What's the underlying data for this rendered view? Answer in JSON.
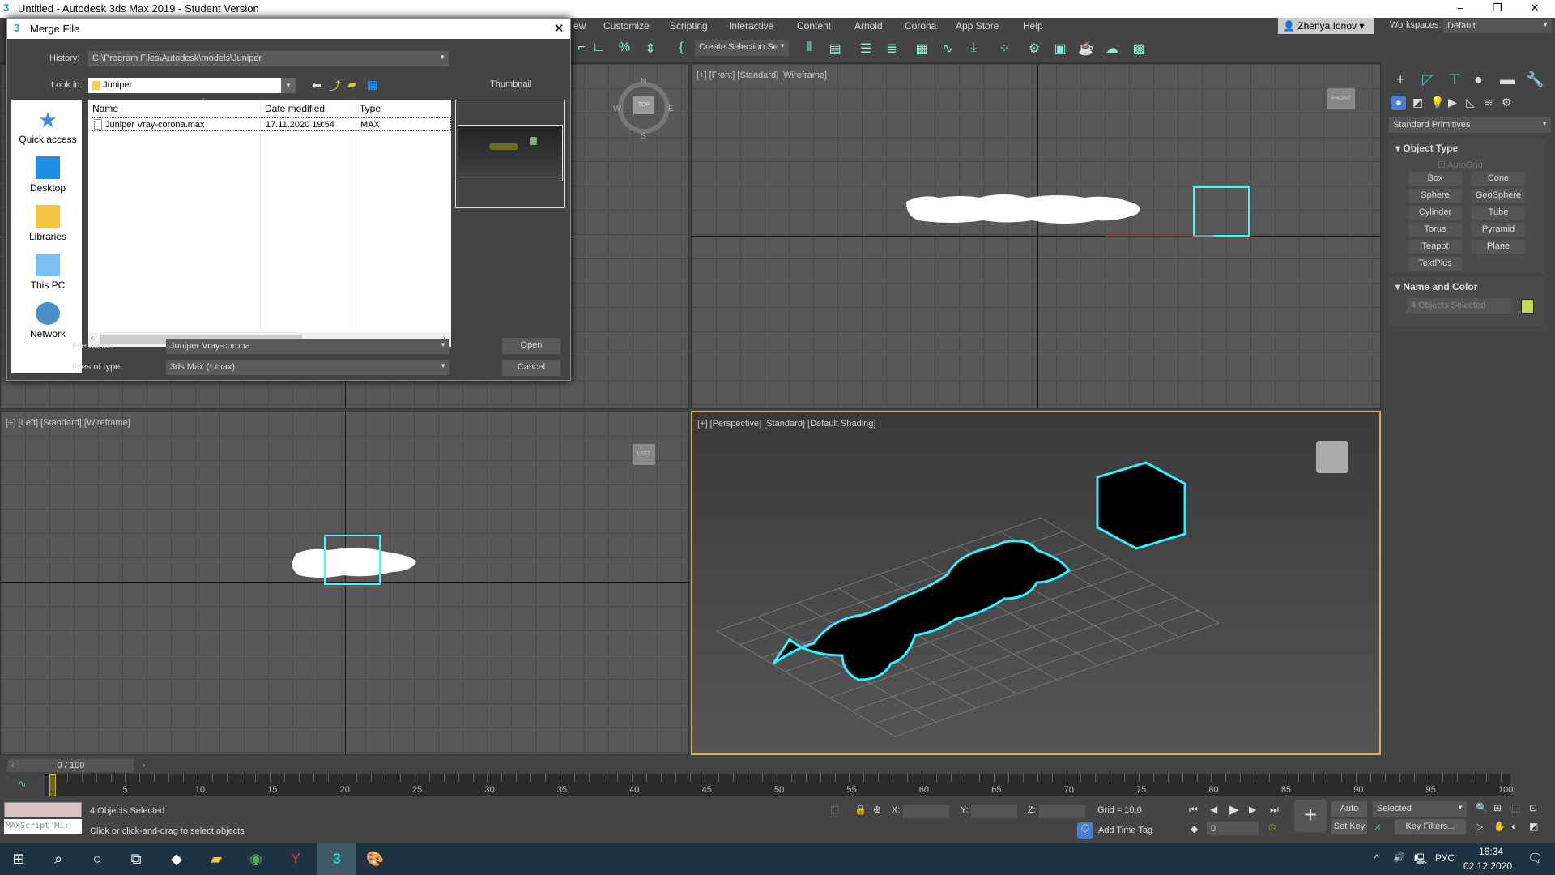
{
  "window": {
    "title": "Untitled - Autodesk 3ds Max 2019 - Student Version",
    "minimize": "–",
    "restore": "❐",
    "close": "✕"
  },
  "menu": {
    "items": [
      "ew",
      "Customize",
      "Scripting",
      "Interactive",
      "Content",
      "Arnold",
      "Corona",
      "App Store",
      "Help"
    ],
    "user": "Zhenya Ionov",
    "workspaces_label": "Workspaces:",
    "workspace": "Default"
  },
  "toolbar": {
    "selection_set": "Create Selection Se"
  },
  "viewports": {
    "front": "[+] [Front] [Standard] [Wireframe]",
    "left": "[+] [Left] [Standard] [Wireframe]",
    "perspective": "[+] [Perspective] [Standard] [Default Shading]",
    "top_label": "TOP",
    "front_label": "FRONT",
    "left_label": "LEFT",
    "compass": {
      "n": "N",
      "s": "S",
      "e": "E",
      "w": "W"
    }
  },
  "command_panel": {
    "category": "Standard Primitives",
    "object_type": "Object Type",
    "autogrid": "AutoGrid",
    "buttons": [
      "Box",
      "Cone",
      "Sphere",
      "GeoSphere",
      "Cylinder",
      "Tube",
      "Torus",
      "Pyramid",
      "Teapot",
      "Plane",
      "TextPlus"
    ],
    "name_and_color": "Name and Color",
    "name_value": "4 Objects Selected",
    "color": "#c8d655"
  },
  "dialog": {
    "title": "Merge File",
    "history_label": "History:",
    "history_value": "C:\\Program Files\\Autodesk\\models\\Juniper",
    "lookin_label": "Look in:",
    "lookin_value": "Juniper",
    "thumbnail_label": "Thumbnail",
    "places": [
      "Quick access",
      "Desktop",
      "Libraries",
      "This PC",
      "Network"
    ],
    "columns": [
      "Name",
      "Date modified",
      "Type"
    ],
    "files": [
      {
        "name": "Juniper Vray-corona.max",
        "date": "17.11.2020 19:54",
        "type": "MAX"
      }
    ],
    "filename_label": "File name:",
    "filename_value": "Juniper Vray-corona",
    "filetype_label": "Files of type:",
    "filetype_value": "3ds Max (*.max)",
    "open": "Open",
    "cancel": "Cancel"
  },
  "timeline": {
    "frame": "0 / 100",
    "current": 0,
    "start": 0,
    "end": 100,
    "labels": [
      "0",
      "5",
      "10",
      "15",
      "20",
      "25",
      "30",
      "35",
      "40",
      "45",
      "50",
      "55",
      "60",
      "65",
      "70",
      "75",
      "80",
      "85",
      "90",
      "95",
      "100"
    ]
  },
  "status": {
    "selected": "4 Objects Selected",
    "prompt": "Click or click-and-drag to select objects",
    "maxscript": "MAXScript Mi:",
    "x_label": "X:",
    "y_label": "Y:",
    "z_label": "Z:",
    "grid": "Grid = 10,0",
    "add_time_tag": "Add Time Tag",
    "auto_key": "Auto Key",
    "set_key": "Set Key",
    "key_mode": "Selected",
    "key_filters": "Key Filters...",
    "frame_value": "0"
  },
  "taskbar": {
    "time": "16:34",
    "date": "02.12.2020",
    "lang": "РУС"
  }
}
